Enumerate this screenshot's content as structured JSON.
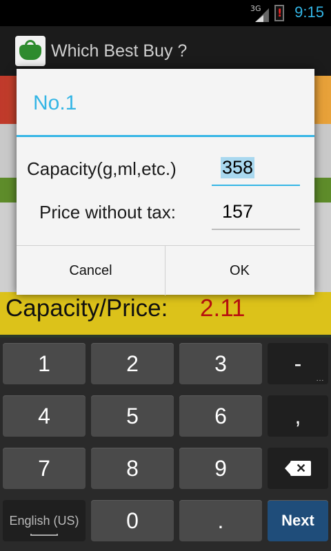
{
  "status_bar": {
    "network": "3G",
    "time": "9:15"
  },
  "action_bar": {
    "title": "Which Best Buy ?"
  },
  "background": {
    "result_label": "Capacity/Price:",
    "result_value": "2.11"
  },
  "dialog": {
    "title": "No.1",
    "capacity_label": "Capacity(g,ml,etc.)",
    "capacity_value": "358",
    "price_label": "Price without tax:",
    "price_value": "157",
    "cancel_label": "Cancel",
    "ok_label": "OK"
  },
  "keyboard": {
    "keys": [
      "1",
      "2",
      "3",
      "-",
      "4",
      "5",
      "6",
      ",",
      "7",
      "8",
      "9",
      "0",
      "."
    ],
    "language_label": "English (US)",
    "next_label": "Next"
  },
  "colors": {
    "accent": "#33b5e5",
    "result_value": "#b8100f",
    "next_key": "#1f4d7a"
  }
}
